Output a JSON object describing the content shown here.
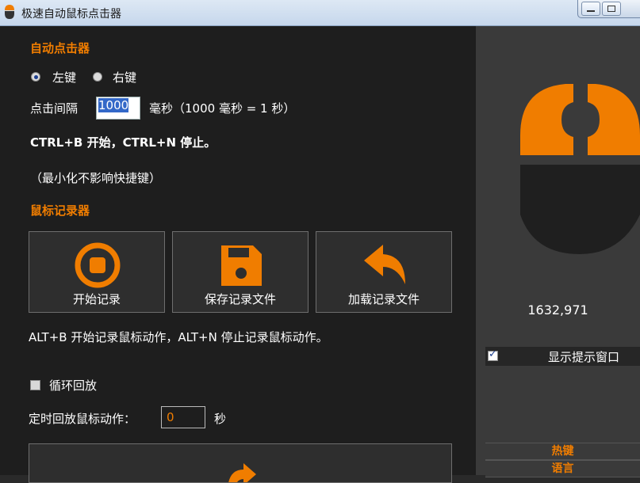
{
  "window": {
    "title": "极速自动鼠标点击器"
  },
  "auto_clicker": {
    "heading": "自动点击器",
    "left_label": "左键",
    "right_label": "右键",
    "interval_label": "点击间隔",
    "interval_value": "1000",
    "interval_unit": "毫秒（1000 毫秒 = 1 秒）",
    "hotkey_text": "CTRL+B 开始，CTRL+N 停止。",
    "note_text": "（最小化不影响快捷键）",
    "selected_button": "left"
  },
  "recorder": {
    "heading": "鼠标记录器",
    "buttons": [
      {
        "label": "开始记录",
        "icon": "record-icon"
      },
      {
        "label": "保存记录文件",
        "icon": "save-icon"
      },
      {
        "label": "加载记录文件",
        "icon": "load-icon"
      }
    ],
    "hotkey_text": "ALT+B 开始记录鼠标动作，ALT+N 停止记录鼠标动作。",
    "loop_label": "循环回放",
    "loop_checked": false,
    "timer_label": "定时回放鼠标动作：",
    "timer_value": "0",
    "timer_unit": "秒"
  },
  "sidebar": {
    "coordinates": "1632,971",
    "show_tip_label": "显示提示窗口",
    "show_tip_checked": true,
    "hotkey_label": "热键",
    "language_label": "语言"
  },
  "colors": {
    "accent": "#f07d00",
    "panel": "#1e1e1e",
    "side": "#3a3a3a"
  }
}
